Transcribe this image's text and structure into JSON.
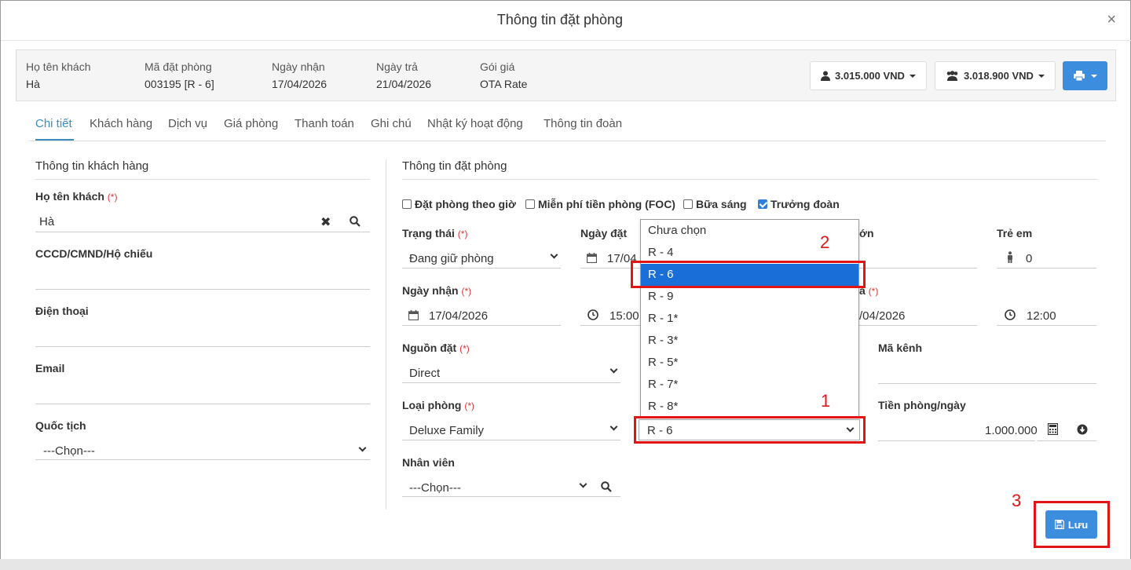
{
  "modal": {
    "title": "Thông tin đặt phòng",
    "close": "×"
  },
  "info": {
    "guest_label": "Họ tên khách",
    "guest_value": "Hà",
    "code_label": "Mã đặt phòng",
    "code_value": "003195 [R - 6]",
    "checkin_label": "Ngày nhận",
    "checkin_value": "17/04/2026",
    "checkout_label": "Ngày trả",
    "checkout_value": "21/04/2026",
    "rate_label": "Gói giá",
    "rate_value": "OTA Rate",
    "amount1": "3.015.000 VND",
    "amount2": "3.018.900 VND"
  },
  "tabs": [
    "Chi tiết",
    "Khách hàng",
    "Dịch vụ",
    "Giá phòng",
    "Thanh toán",
    "Ghi chú",
    "Nhật ký hoạt động",
    "Thông tin đoàn"
  ],
  "left": {
    "section": "Thông tin khách hàng",
    "name_label": "Họ tên khách",
    "name_value": "Hà",
    "id_label": "CCCD/CMND/Hộ chiếu",
    "phone_label": "Điện thoại",
    "email_label": "Email",
    "nation_label": "Quốc tịch",
    "nation_value": "---Chọn---"
  },
  "right": {
    "section": "Thông tin đặt phòng",
    "cb_hourly": "Đặt phòng theo giờ",
    "cb_foc": "Miễn phí tiền phòng (FOC)",
    "cb_breakfast": "Bữa sáng",
    "cb_leader": "Trưởng đoàn",
    "status_label": "Trạng thái",
    "status_value": "Đang giữ phòng",
    "bookdate_label": "Ngày đặt",
    "bookdate_value": "17/04",
    "adult_label": "ớn",
    "child_label": "Trẻ em",
    "child_value": "0",
    "checkin_label": "Ngày nhận",
    "checkin_date": "17/04/2026",
    "checkin_time": "15:00",
    "checkout_label_tail": "ả",
    "checkout_date": "/04/2026",
    "checkout_time": "12:00",
    "source_label": "Nguồn đặt",
    "source_value": "Direct",
    "channel_label": "Mã kênh",
    "roomtype_label": "Loại phòng",
    "roomtype_value": "Deluxe Family",
    "room_value": "R - 6",
    "price_label": "Tiền phòng/ngày",
    "price_value": "1.000.000",
    "staff_label": "Nhân viên",
    "staff_value": "---Chọn---",
    "required_mark": "(*)"
  },
  "room_options": [
    "Chưa chọn",
    "R - 4",
    "R - 6",
    "R - 9",
    "R - 1*",
    "R - 3*",
    "R - 5*",
    "R - 7*",
    "R - 8*"
  ],
  "annotations": {
    "n1": "1",
    "n2": "2",
    "n3": "3"
  },
  "save_label": "Lưu",
  "colors": {
    "primary": "#3c8dde",
    "tab_active": "#3c8dbc",
    "highlight": "#e31414",
    "selected": "#1a6ed8"
  }
}
